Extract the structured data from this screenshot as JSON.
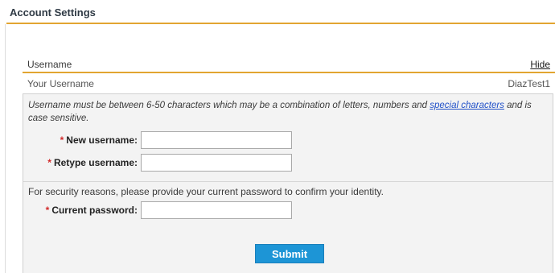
{
  "page": {
    "title": "Account Settings"
  },
  "section": {
    "label": "Username",
    "toggle_label": "Hide"
  },
  "current": {
    "label": "Your Username",
    "value": "DiazTest1"
  },
  "help": {
    "text_before": "Username must be between 6-50 characters which may be a combination of letters, numbers and ",
    "link": "special characters",
    "text_after": " and is case sensitive."
  },
  "form": {
    "required_marker": "*",
    "new_username_label": "New username:",
    "retype_username_label": "Retype username:",
    "security_note": "For security reasons, please provide your current password to confirm your identity.",
    "current_password_label": "Current password:",
    "submit_label": "Submit"
  },
  "colors": {
    "accent_rule": "#e2a531",
    "submit_bg": "#1d95d6",
    "required": "#d12a2a",
    "link": "#1f4fc8"
  }
}
